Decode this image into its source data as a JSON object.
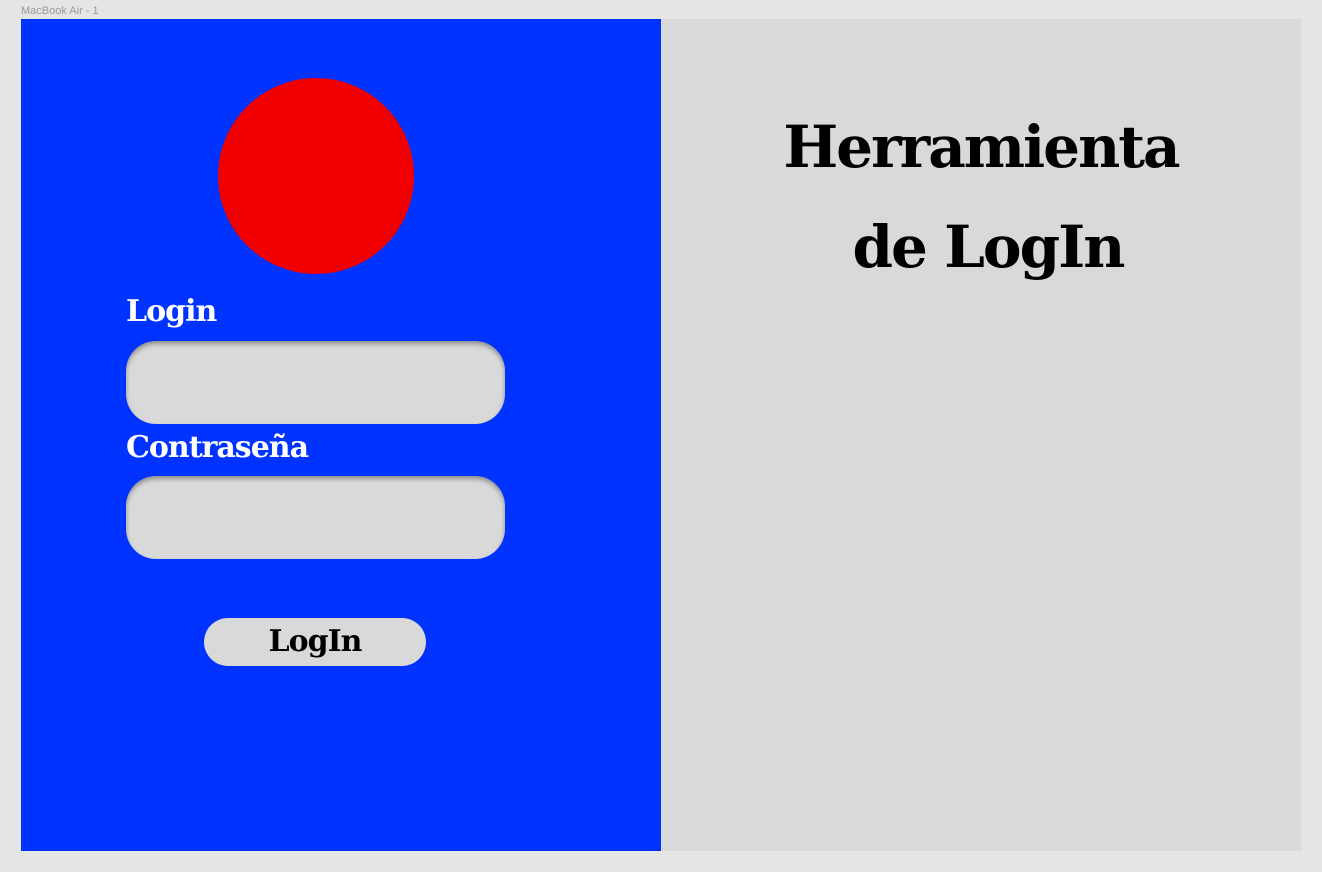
{
  "frame": {
    "label": "MacBook Air - 1"
  },
  "colors": {
    "canvas_bg": "#e5e5e5",
    "left_panel_bg": "#0033ff",
    "right_panel_bg": "#d9d9d9",
    "avatar_circle": "#f00000",
    "field_bg": "#d9d9d9",
    "button_bg": "#d9d9d9"
  },
  "login_form": {
    "avatar_icon": "red-circle",
    "username_label": "Login",
    "username_value": "",
    "password_label": "Contraseña",
    "password_value": "",
    "submit_label": "LogIn"
  },
  "hero": {
    "title_line_1": "Herramienta",
    "title_line_2": "de LogIn"
  }
}
